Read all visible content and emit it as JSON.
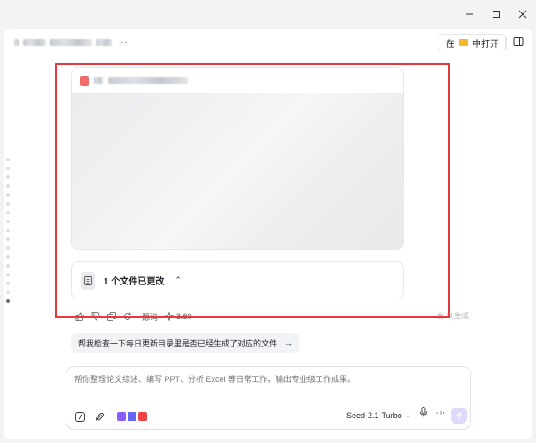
{
  "window": {
    "controls": [
      "minimize",
      "maximize",
      "close"
    ]
  },
  "header": {
    "dots": "··",
    "open_in_prefix": "在",
    "open_in_label": "中打开"
  },
  "preview": {
    "file_type_color": "#f26b6b"
  },
  "files_changed": {
    "label": "1 个文件已更改"
  },
  "actions": {
    "source_label": "源码",
    "version_label": "3.60",
    "right_note": "由 AI 生成"
  },
  "suggestion": {
    "text": "帮我检查一下每日更新目录里是否已经生成了对应的文件",
    "arrow": "→"
  },
  "composer": {
    "placeholder": "帮你整理论文综述、编写 PPT、分析 Excel 等日常工作，输出专业级工作成果。",
    "model": "Seed-2.1-Turbo"
  },
  "colors": {
    "highlight": "#e5393e",
    "send_bg": "#dcd9fb",
    "folder": "#f5b731"
  }
}
